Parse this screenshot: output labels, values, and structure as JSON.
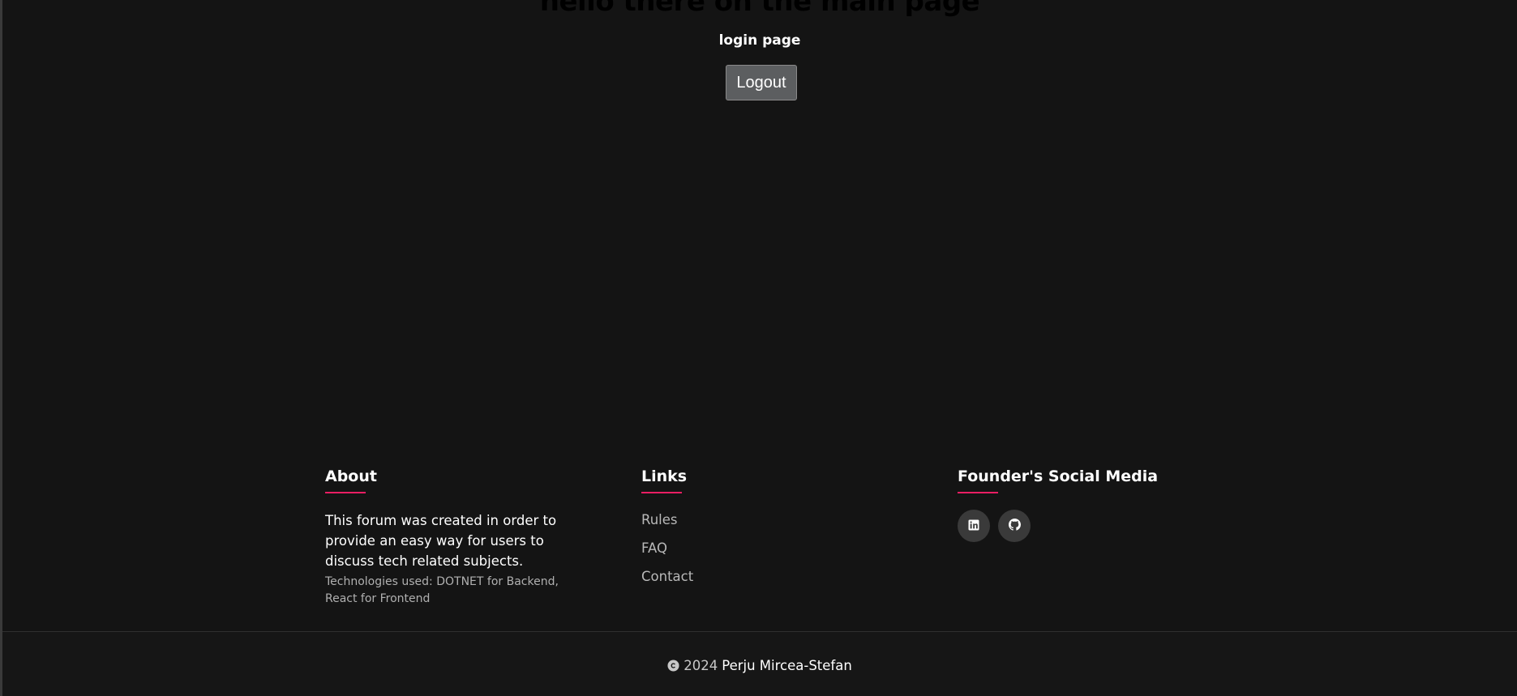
{
  "main": {
    "title": "hello there on the main page",
    "subtitle": "login page",
    "logout_label": "Logout"
  },
  "footer": {
    "about": {
      "heading": "About",
      "text": "This forum was created in order to provide an easy way for users to discuss tech related subjects.",
      "tech": "Technologies used: DOTNET for Backend, React for Frontend"
    },
    "links": {
      "heading": "Links",
      "items": [
        "Rules",
        "FAQ",
        "Contact"
      ]
    },
    "social": {
      "heading": "Founder's Social Media",
      "icons": [
        "linkedin-icon",
        "github-icon"
      ]
    },
    "copyright": {
      "year": "2024",
      "author": "Perju Mircea-Stefan"
    }
  },
  "colors": {
    "background": "#141414",
    "accent": "#e91e63",
    "button": "#5c5e60"
  }
}
